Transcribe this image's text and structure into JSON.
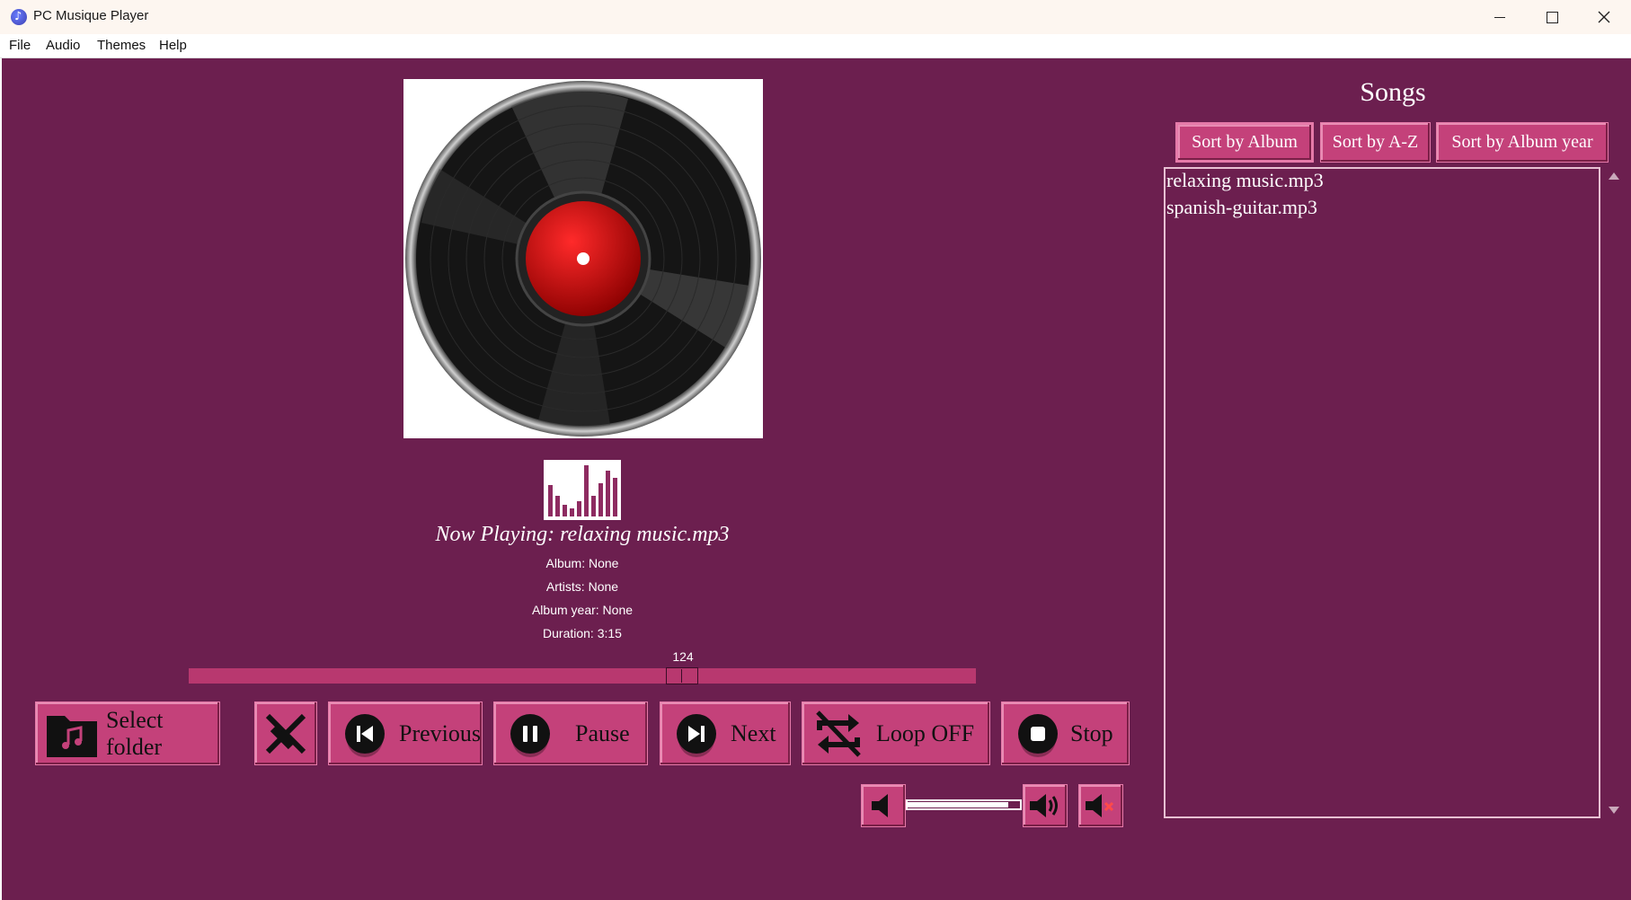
{
  "window": {
    "title": "PC Musique Player"
  },
  "menu": {
    "items": [
      "File",
      "Audio",
      "Themes",
      "Help"
    ]
  },
  "now_playing": {
    "title": "Now Playing: relaxing music.mp3",
    "album": "Album: None",
    "artists": "Artists: None",
    "album_year": "Album year: None",
    "duration": "Duration: 3:15"
  },
  "seek": {
    "value": "124"
  },
  "controls": {
    "select_folder": "Select folder",
    "previous": "Previous",
    "pause": "Pause",
    "next": "Next",
    "loop": "Loop OFF",
    "stop": "Stop"
  },
  "songs": {
    "title": "Songs",
    "sort_album": "Sort by Album",
    "sort_az": "Sort by A-Z",
    "sort_year": "Sort by Album year",
    "items": [
      "relaxing music.mp3",
      "spanish-guitar.mp3"
    ]
  },
  "colors": {
    "background": "#6c1f4f",
    "button": "#c4417a",
    "seek_track": "#b8386f"
  },
  "icons": [
    "app-icon",
    "folder-music-icon",
    "clear-icon",
    "previous-icon",
    "pause-icon",
    "next-icon",
    "loop-off-icon",
    "stop-icon",
    "volume-down-icon",
    "volume-up-icon",
    "mute-icon"
  ]
}
